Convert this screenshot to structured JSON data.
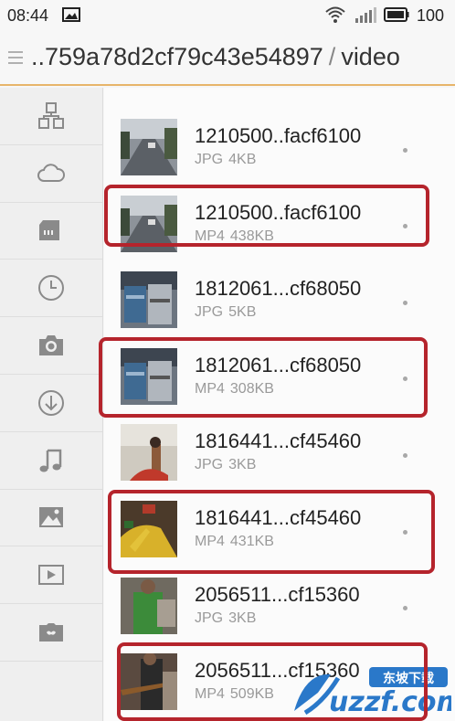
{
  "status": {
    "time": "08:44",
    "battery": "100"
  },
  "header": {
    "path_parent": "..759a78d2cf79c43e54897",
    "separator": "/",
    "path_current": "video"
  },
  "sidebar": {
    "items": [
      "categories-icon",
      "cloud-icon",
      "sd-card-icon",
      "recent-icon",
      "camera-icon",
      "download-icon",
      "music-icon",
      "image-icon",
      "video-icon",
      "game-icon"
    ]
  },
  "files": [
    {
      "name": "1210500..facf6100",
      "type": "JPG",
      "size": "4KB",
      "thumb": "street"
    },
    {
      "name": "1210500..facf6100",
      "type": "MP4",
      "size": "438KB",
      "thumb": "street"
    },
    {
      "name": "1812061...cf68050",
      "type": "JPG",
      "size": "5KB",
      "thumb": "shelves"
    },
    {
      "name": "1812061...cf68050",
      "type": "MP4",
      "size": "308KB",
      "thumb": "shelves"
    },
    {
      "name": "1816441...cf45460",
      "type": "JPG",
      "size": "3KB",
      "thumb": "market-light"
    },
    {
      "name": "1816441...cf45460",
      "type": "MP4",
      "size": "431KB",
      "thumb": "market"
    },
    {
      "name": "2056511...cf15360",
      "type": "JPG",
      "size": "3KB",
      "thumb": "person"
    },
    {
      "name": "2056511...cf15360",
      "type": "MP4",
      "size": "509KB",
      "thumb": "guitar"
    }
  ],
  "highlighted_rows": [
    1,
    3,
    5,
    7
  ],
  "watermark": {
    "text": "uzzf.com",
    "subtext": "东坡下载"
  }
}
